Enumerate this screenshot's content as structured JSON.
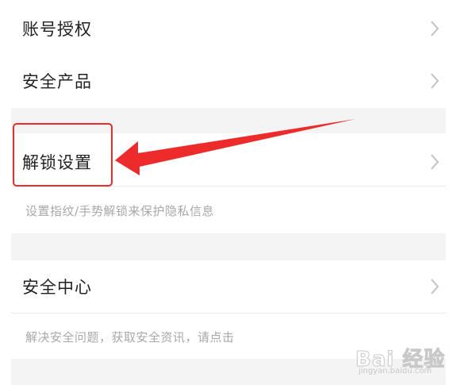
{
  "menu": {
    "account_auth": "账号授权",
    "security_products": "安全产品",
    "unlock_settings": "解锁设置",
    "unlock_description": "设置指纹/手势解锁来保护隐私信息",
    "security_center": "安全中心",
    "security_center_description": "解决安全问题，获取安全资讯，请点击"
  },
  "icons": {
    "row_chevron": "chevron-right-icon",
    "annotation": "arrow-pointer-icon"
  },
  "watermark": {
    "main": "Bai 经验",
    "sub": "jingyan.baidu.com"
  },
  "colors": {
    "annotation_red": "#ee2b2b",
    "row_text": "#222222",
    "description_text": "#a8a8a8",
    "section_background": "#f4f4f4",
    "chevron": "#c2c2c2"
  }
}
